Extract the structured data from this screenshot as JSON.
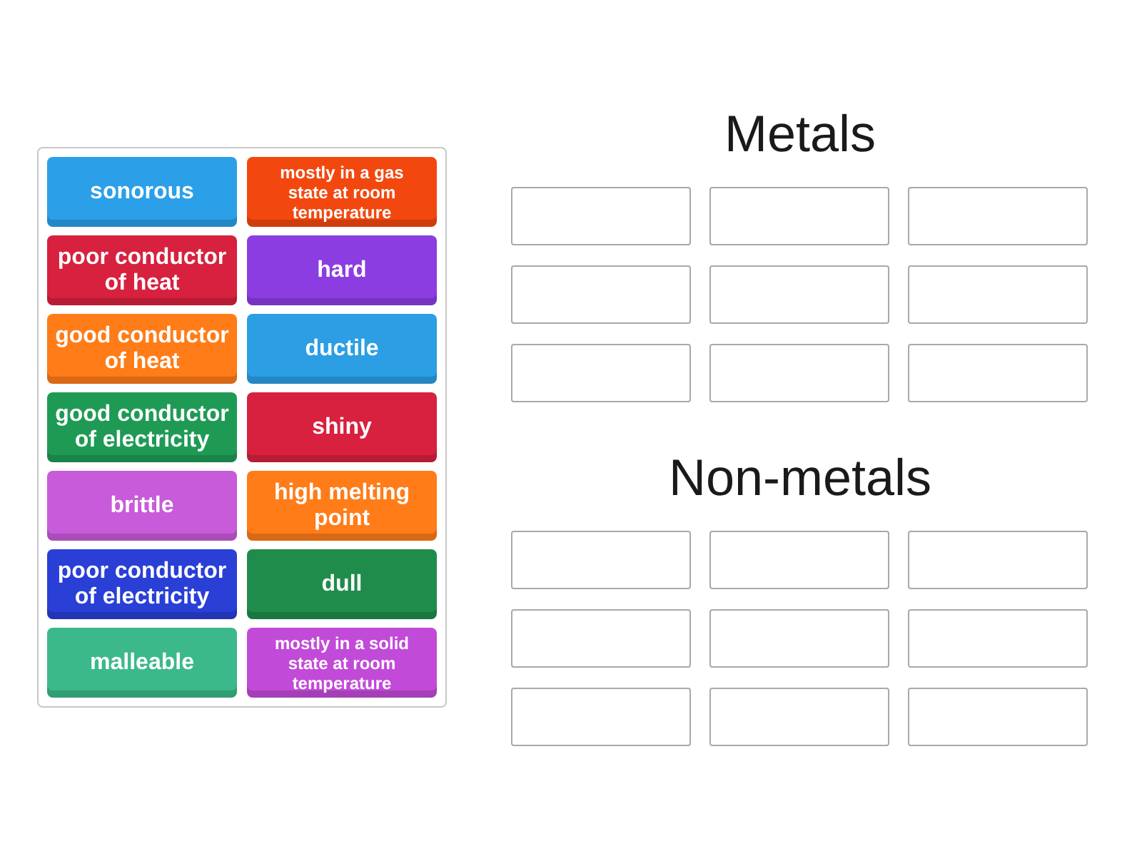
{
  "tiles": [
    {
      "label": "sonorous",
      "color": "#2ba0e8",
      "kind": "large"
    },
    {
      "label": "mostly in a gas state at room temperature",
      "color": "#f2480f",
      "kind": "small"
    },
    {
      "label": "poor conductor of heat",
      "color": "#d7213f",
      "kind": "large"
    },
    {
      "label": "hard",
      "color": "#8b3de2",
      "kind": "large"
    },
    {
      "label": "good conductor of heat",
      "color": "#ff7c18",
      "kind": "large"
    },
    {
      "label": "ductile",
      "color": "#2b9ee4",
      "kind": "large"
    },
    {
      "label": "good conductor of electricity",
      "color": "#1f9a55",
      "kind": "large"
    },
    {
      "label": "shiny",
      "color": "#d7213f",
      "kind": "large"
    },
    {
      "label": "brittle",
      "color": "#c85bd9",
      "kind": "large"
    },
    {
      "label": "high melting point",
      "color": "#ff7c18",
      "kind": "large"
    },
    {
      "label": "poor conductor of electricity",
      "color": "#2a3fd6",
      "kind": "large"
    },
    {
      "label": "dull",
      "color": "#1f8c4b",
      "kind": "large"
    },
    {
      "label": "malleable",
      "color": "#3bb98a",
      "kind": "large"
    },
    {
      "label": "mostly in a solid state at room temperature",
      "color": "#c24ad8",
      "kind": "small"
    }
  ],
  "groups": [
    {
      "title": "Metals"
    },
    {
      "title": "Non-metals"
    }
  ]
}
